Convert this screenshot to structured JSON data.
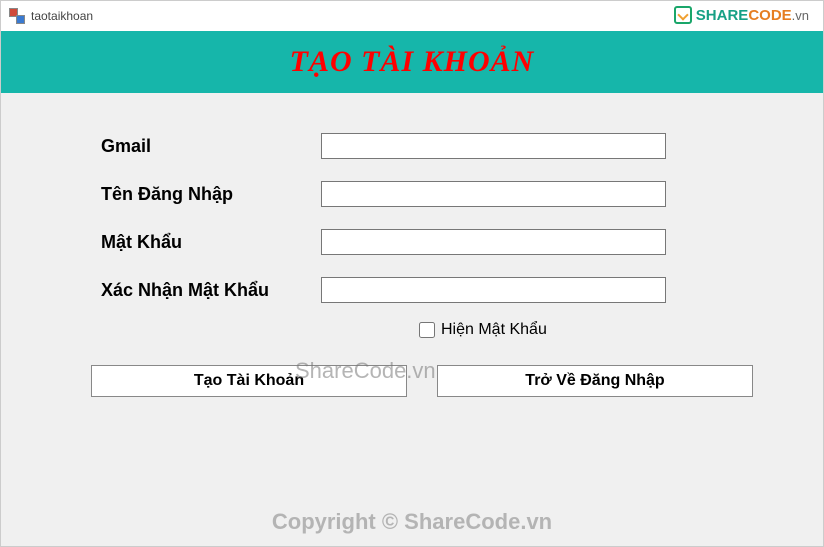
{
  "window": {
    "title": "taotaikhoan"
  },
  "brand": {
    "share": "SHARE",
    "code": "CODE",
    "vn": ".vn"
  },
  "header": {
    "title": "TẠO TÀI KHOẢN"
  },
  "form": {
    "gmail": {
      "label": "Gmail",
      "value": ""
    },
    "username": {
      "label": "Tên Đăng Nhập",
      "value": ""
    },
    "password": {
      "label": "Mật Khẩu",
      "value": ""
    },
    "confirm": {
      "label": "Xác Nhận Mật Khẩu",
      "value": ""
    },
    "show_password": {
      "label": "Hiện Mật Khẩu",
      "checked": false
    }
  },
  "buttons": {
    "create": "Tạo Tài Khoản",
    "back": "Trở Về Đăng Nhập"
  },
  "watermark": {
    "center": "ShareCode.vn",
    "bottom": "Copyright © ShareCode.vn"
  }
}
